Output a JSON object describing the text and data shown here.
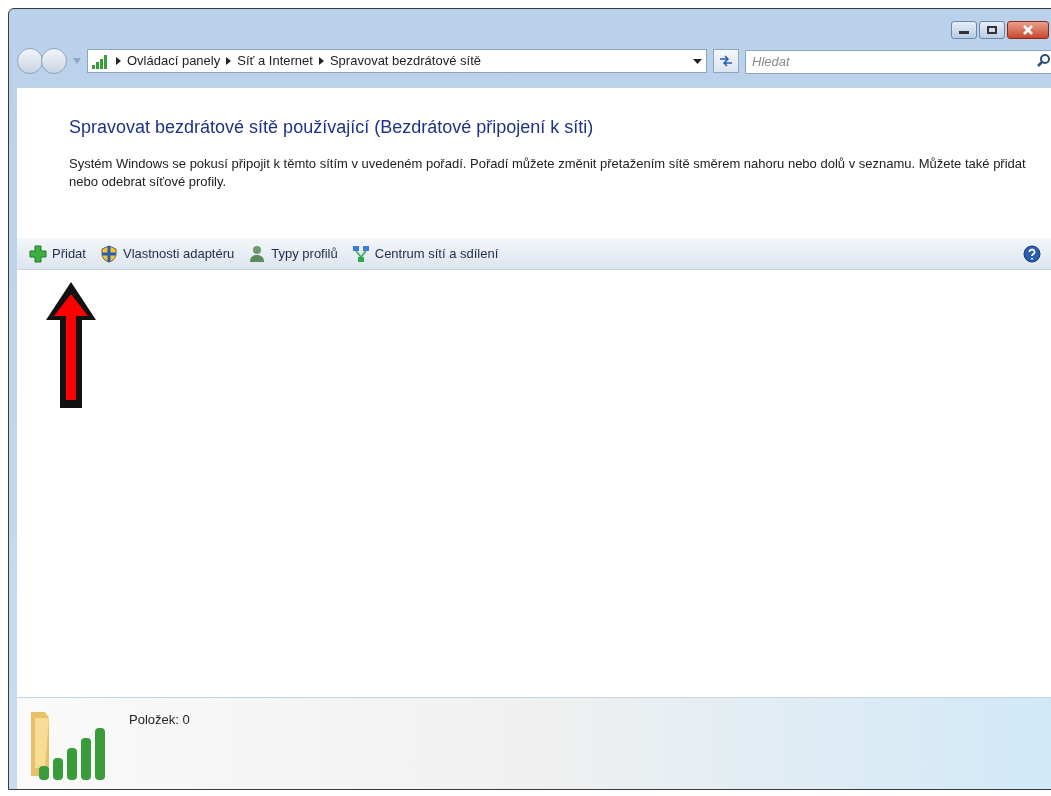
{
  "address_bar": {
    "breadcrumbs": [
      "Ovládací panely",
      "Síť a Internet",
      "Spravovat bezdrátové sítě"
    ],
    "search": {
      "placeholder": "Hledat"
    }
  },
  "page": {
    "title": "Spravovat bezdrátové sítě používající (Bezdrátové připojení k síti)",
    "description": "Systém Windows se pokusí připojit k těmto sítím v uvedeném pořadí. Pořadí můžete změnit přetažením sítě směrem nahoru nebo dolů v seznamu. Můžete také přidat nebo odebrat síťové profily."
  },
  "toolbar": [
    {
      "kind": "add",
      "label": "Přidat"
    },
    {
      "kind": "shield",
      "label": "Vlastnosti adaptéru"
    },
    {
      "kind": "person",
      "label": "Typy profilů"
    },
    {
      "kind": "network",
      "label": "Centrum sítí a sdílení"
    }
  ],
  "status_bar": {
    "text": "Položek: 0"
  }
}
